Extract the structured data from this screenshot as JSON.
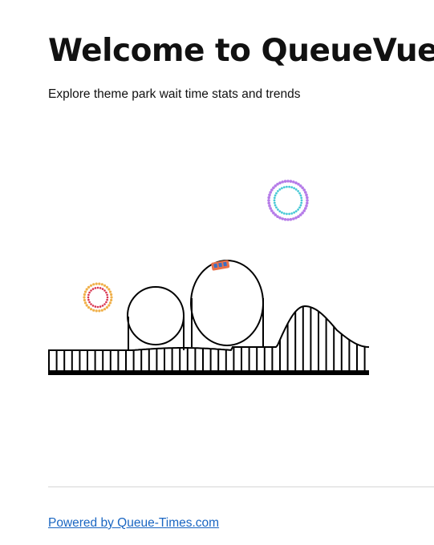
{
  "header": {
    "title": "Welcome to QueueVue",
    "subtitle": "Explore theme park wait time stats and trends"
  },
  "footer": {
    "link_text": "Powered by Queue-Times.com"
  },
  "colors": {
    "text": "#111111",
    "link": "#1a66c2",
    "divider": "#d6d6d6",
    "track": "#000000",
    "firework_outer_purple": "#b57be8",
    "firework_inner_cyan": "#48c9d6",
    "firework_outer_orange": "#f0b04a",
    "firework_inner_red": "#d8344f",
    "car_body": "#e8704a",
    "car_seats": "#3a6fc4"
  },
  "illustration": {
    "type": "roller-coaster",
    "elements": [
      "track",
      "support-beams",
      "loop",
      "loop",
      "hill",
      "coaster-car",
      "firework",
      "firework"
    ]
  }
}
